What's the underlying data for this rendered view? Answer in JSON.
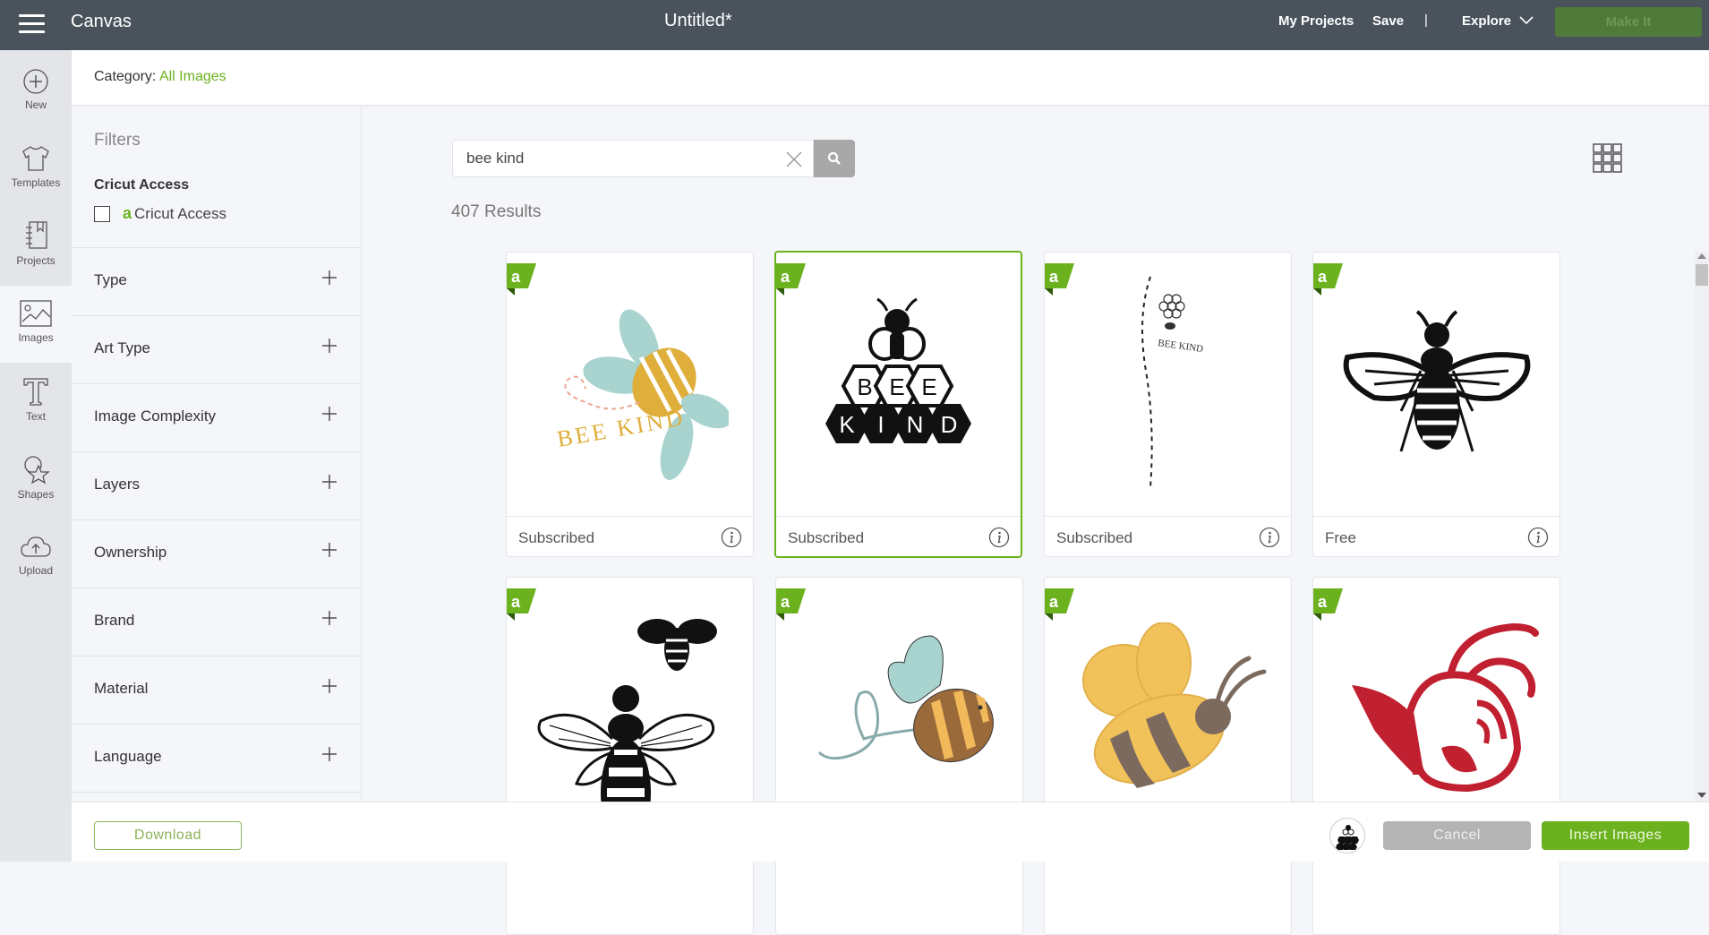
{
  "topbar": {
    "app_title": "Canvas",
    "doc_title": "Untitled*",
    "my_projects": "My Projects",
    "save": "Save",
    "separator": "|",
    "explore": "Explore",
    "make_it": "Make It"
  },
  "rail": {
    "items": [
      {
        "label": "New",
        "icon": "plus-circle-icon"
      },
      {
        "label": "Templates",
        "icon": "tshirt-icon"
      },
      {
        "label": "Projects",
        "icon": "notebook-icon"
      },
      {
        "label": "Images",
        "icon": "image-icon",
        "active": true
      },
      {
        "label": "Text",
        "icon": "text-icon"
      },
      {
        "label": "Shapes",
        "icon": "shapes-icon"
      },
      {
        "label": "Upload",
        "icon": "cloud-upload-icon"
      }
    ]
  },
  "category": {
    "label": "Category:",
    "value": "All Images"
  },
  "filters": {
    "title": "Filters",
    "access_heading": "Cricut Access",
    "access_option": "Cricut Access",
    "access_checked": false,
    "groups": [
      {
        "label": "Type"
      },
      {
        "label": "Art Type"
      },
      {
        "label": "Image Complexity"
      },
      {
        "label": "Layers"
      },
      {
        "label": "Ownership"
      },
      {
        "label": "Brand"
      },
      {
        "label": "Material"
      },
      {
        "label": "Language"
      }
    ]
  },
  "search": {
    "value": "bee kind",
    "placeholder": ""
  },
  "results": {
    "count_text": "407 Results",
    "cards": [
      {
        "status": "Subscribed",
        "image": "bee-kind-pastel-bee",
        "selected": false
      },
      {
        "status": "Subscribed",
        "image": "bee-kind-honeycomb",
        "selected": true
      },
      {
        "status": "Subscribed",
        "image": "bee-kind-flower-trail",
        "selected": false
      },
      {
        "status": "Free",
        "image": "black-bee-silhouette",
        "selected": false
      },
      {
        "status": "",
        "image": "two-bees-silhouette",
        "selected": false
      },
      {
        "status": "",
        "image": "brown-bee-loop",
        "selected": false
      },
      {
        "status": "",
        "image": "yellow-cartoon-bee",
        "selected": false
      },
      {
        "status": "",
        "image": "red-hornet-mascot",
        "selected": false
      }
    ]
  },
  "bottom": {
    "download": "Download",
    "cancel": "Cancel",
    "insert": "Insert Images"
  },
  "colors": {
    "accent": "#6cb21f",
    "topbar": "#4a535c",
    "make_it_disabled": "#4f7a3a",
    "cancel_disabled": "#b4b4b4"
  }
}
